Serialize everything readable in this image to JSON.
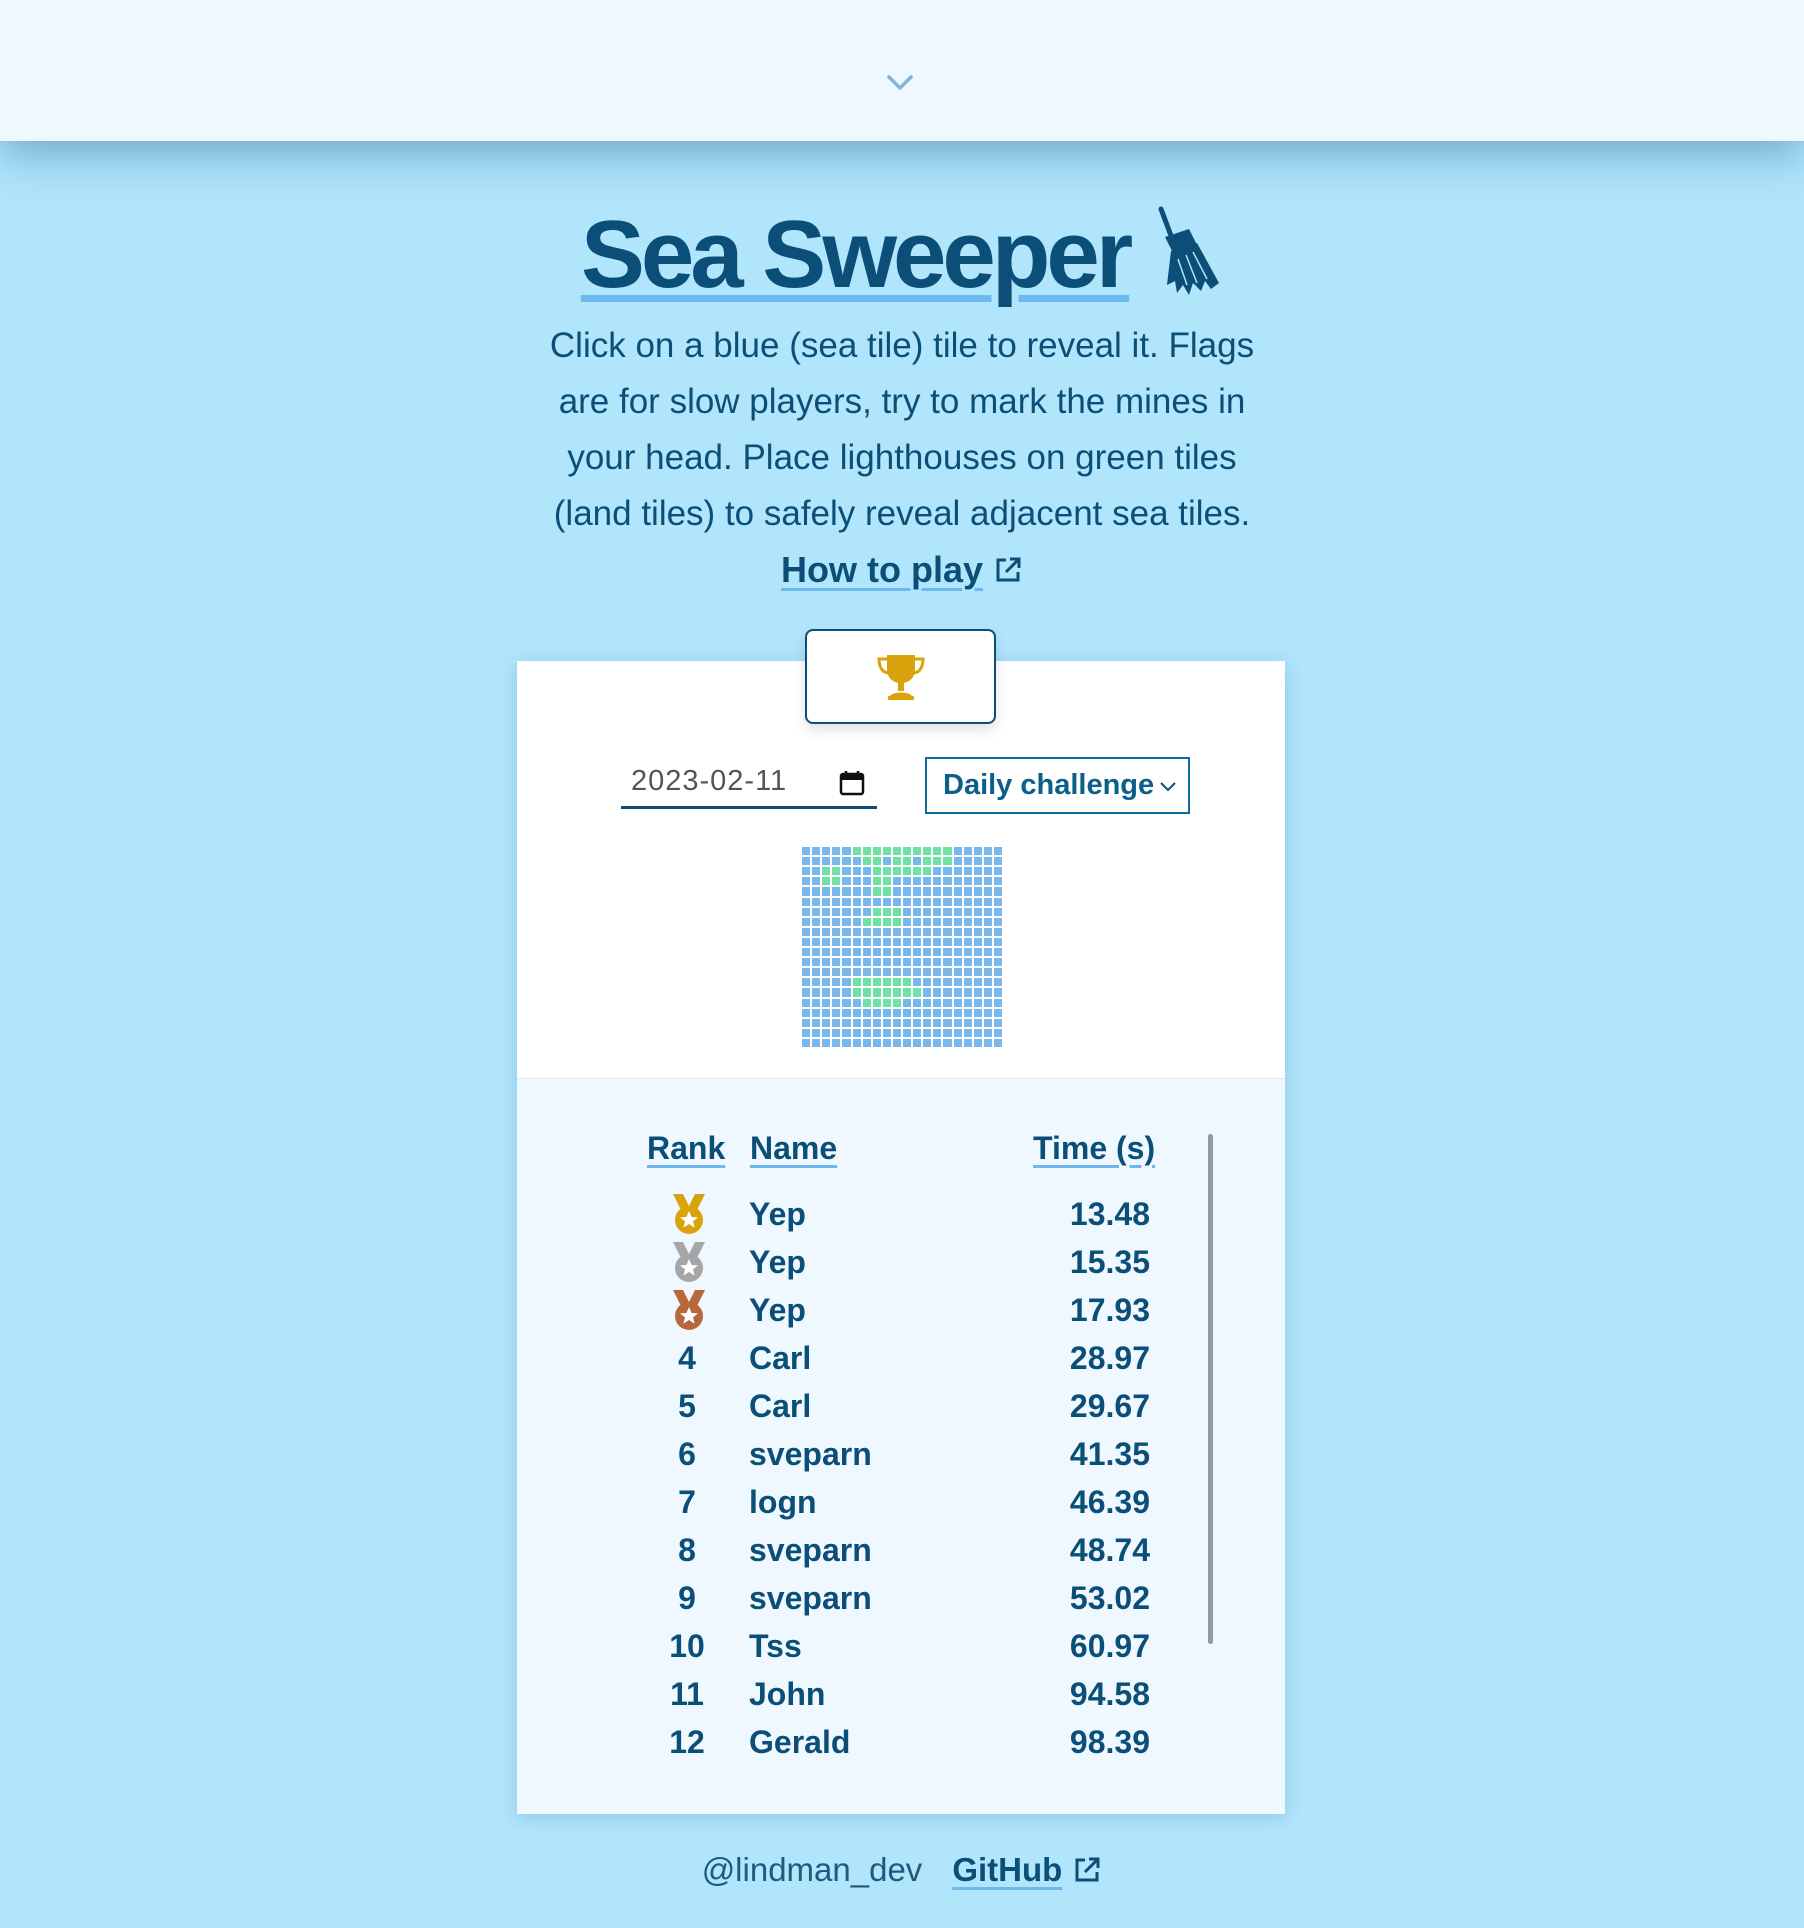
{
  "header": {
    "collapse_icon": "chevron-down-icon"
  },
  "title": {
    "text": "Sea Sweeper",
    "icon": "broom-icon"
  },
  "intro": "Click on a blue (sea tile) tile to reveal it. Flags are for slow players, try to mark the mines in your head. Place lighthouses on green tiles (land tiles) to safely reveal adjacent sea tiles.",
  "how_to_play": {
    "label": "How to play",
    "icon": "external-link-icon"
  },
  "leaderboard_tab": {
    "icon": "trophy-icon"
  },
  "controls": {
    "date_value": "2023-02-11",
    "date_icon": "calendar-icon",
    "mode_selected": "Daily challenge",
    "mode_icon": "chevron-down-icon"
  },
  "minimap": {
    "size": 20,
    "land_cells": [
      [
        0,
        5
      ],
      [
        0,
        6
      ],
      [
        0,
        7
      ],
      [
        0,
        8
      ],
      [
        0,
        9
      ],
      [
        0,
        10
      ],
      [
        0,
        11
      ],
      [
        0,
        12
      ],
      [
        0,
        13
      ],
      [
        0,
        14
      ],
      [
        1,
        6
      ],
      [
        1,
        7
      ],
      [
        1,
        9
      ],
      [
        1,
        10
      ],
      [
        1,
        12
      ],
      [
        1,
        13
      ],
      [
        1,
        14
      ],
      [
        2,
        2
      ],
      [
        2,
        3
      ],
      [
        2,
        7
      ],
      [
        2,
        8
      ],
      [
        2,
        9
      ],
      [
        2,
        10
      ],
      [
        2,
        11
      ],
      [
        2,
        12
      ],
      [
        3,
        2
      ],
      [
        3,
        3
      ],
      [
        3,
        7
      ],
      [
        3,
        8
      ],
      [
        4,
        7
      ],
      [
        4,
        8
      ],
      [
        6,
        7
      ],
      [
        6,
        8
      ],
      [
        6,
        9
      ],
      [
        7,
        6
      ],
      [
        7,
        7
      ],
      [
        7,
        8
      ],
      [
        7,
        9
      ],
      [
        13,
        5
      ],
      [
        13,
        6
      ],
      [
        13,
        7
      ],
      [
        13,
        8
      ],
      [
        13,
        9
      ],
      [
        13,
        10
      ],
      [
        14,
        5
      ],
      [
        14,
        6
      ],
      [
        14,
        7
      ],
      [
        14,
        8
      ],
      [
        14,
        9
      ],
      [
        14,
        10
      ],
      [
        14,
        11
      ],
      [
        15,
        6
      ],
      [
        15,
        7
      ],
      [
        15,
        8
      ],
      [
        15,
        9
      ]
    ],
    "colors": {
      "sea": "#79b8ec",
      "land": "#6fe2a4"
    }
  },
  "table": {
    "headers": {
      "rank": "Rank",
      "name": "Name",
      "time": "Time (s)"
    },
    "rows": [
      {
        "rank": "1",
        "medal": "gold",
        "name": "Yep",
        "time": "13.48"
      },
      {
        "rank": "2",
        "medal": "silver",
        "name": "Yep",
        "time": "15.35"
      },
      {
        "rank": "3",
        "medal": "bronze",
        "name": "Yep",
        "time": "17.93"
      },
      {
        "rank": "4",
        "name": "Carl",
        "time": "28.97"
      },
      {
        "rank": "5",
        "name": "Carl",
        "time": "29.67"
      },
      {
        "rank": "6",
        "name": "sveparn",
        "time": "41.35"
      },
      {
        "rank": "7",
        "name": "logn",
        "time": "46.39"
      },
      {
        "rank": "8",
        "name": "sveparn",
        "time": "48.74"
      },
      {
        "rank": "9",
        "name": "sveparn",
        "time": "53.02"
      },
      {
        "rank": "10",
        "name": "Tss",
        "time": "60.97"
      },
      {
        "rank": "11",
        "name": "John",
        "time": "94.58"
      },
      {
        "rank": "12",
        "name": "Gerald",
        "time": "98.39"
      }
    ]
  },
  "medal_colors": {
    "gold": "#d9a40b",
    "silver": "#a6a6a6",
    "bronze": "#b6683c"
  },
  "footer": {
    "handle": "@lindman_dev",
    "github_label": "GitHub",
    "github_icon": "external-link-icon"
  },
  "colors": {
    "background": "#b0e5fc",
    "primary_text": "#0b4f78",
    "underline": "#6db8ee"
  }
}
